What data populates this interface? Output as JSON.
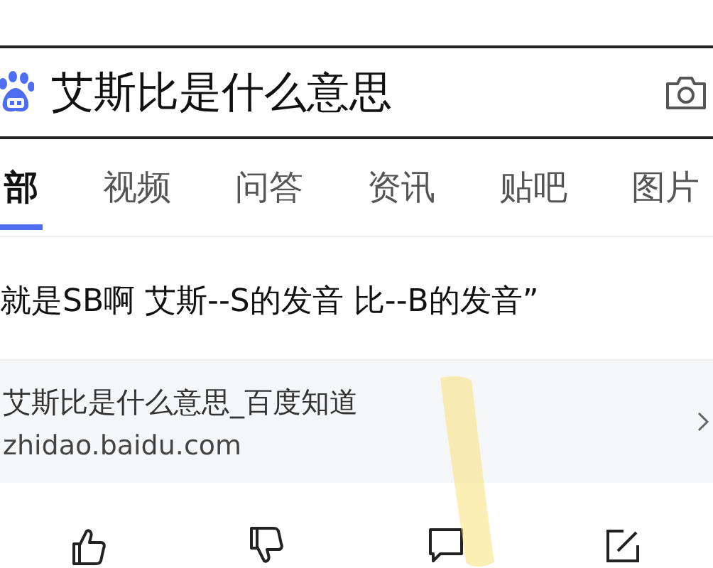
{
  "search": {
    "value": "艾斯比是什么意思"
  },
  "tabs": [
    {
      "label": "部",
      "selected": true
    },
    {
      "label": "视频",
      "selected": false
    },
    {
      "label": "问答",
      "selected": false
    },
    {
      "label": "资讯",
      "selected": false
    },
    {
      "label": "贴吧",
      "selected": false
    },
    {
      "label": "图片",
      "selected": false
    }
  ],
  "answer": {
    "text": "就是SB啊 艾斯--S的发音 比--B的发音”"
  },
  "source": {
    "title": "艾斯比是什么意思_百度知道",
    "url": "zhidao.baidu.com"
  },
  "actions": [
    {
      "kind": "like"
    },
    {
      "kind": "dislike"
    },
    {
      "kind": "comment"
    },
    {
      "kind": "edit"
    }
  ]
}
